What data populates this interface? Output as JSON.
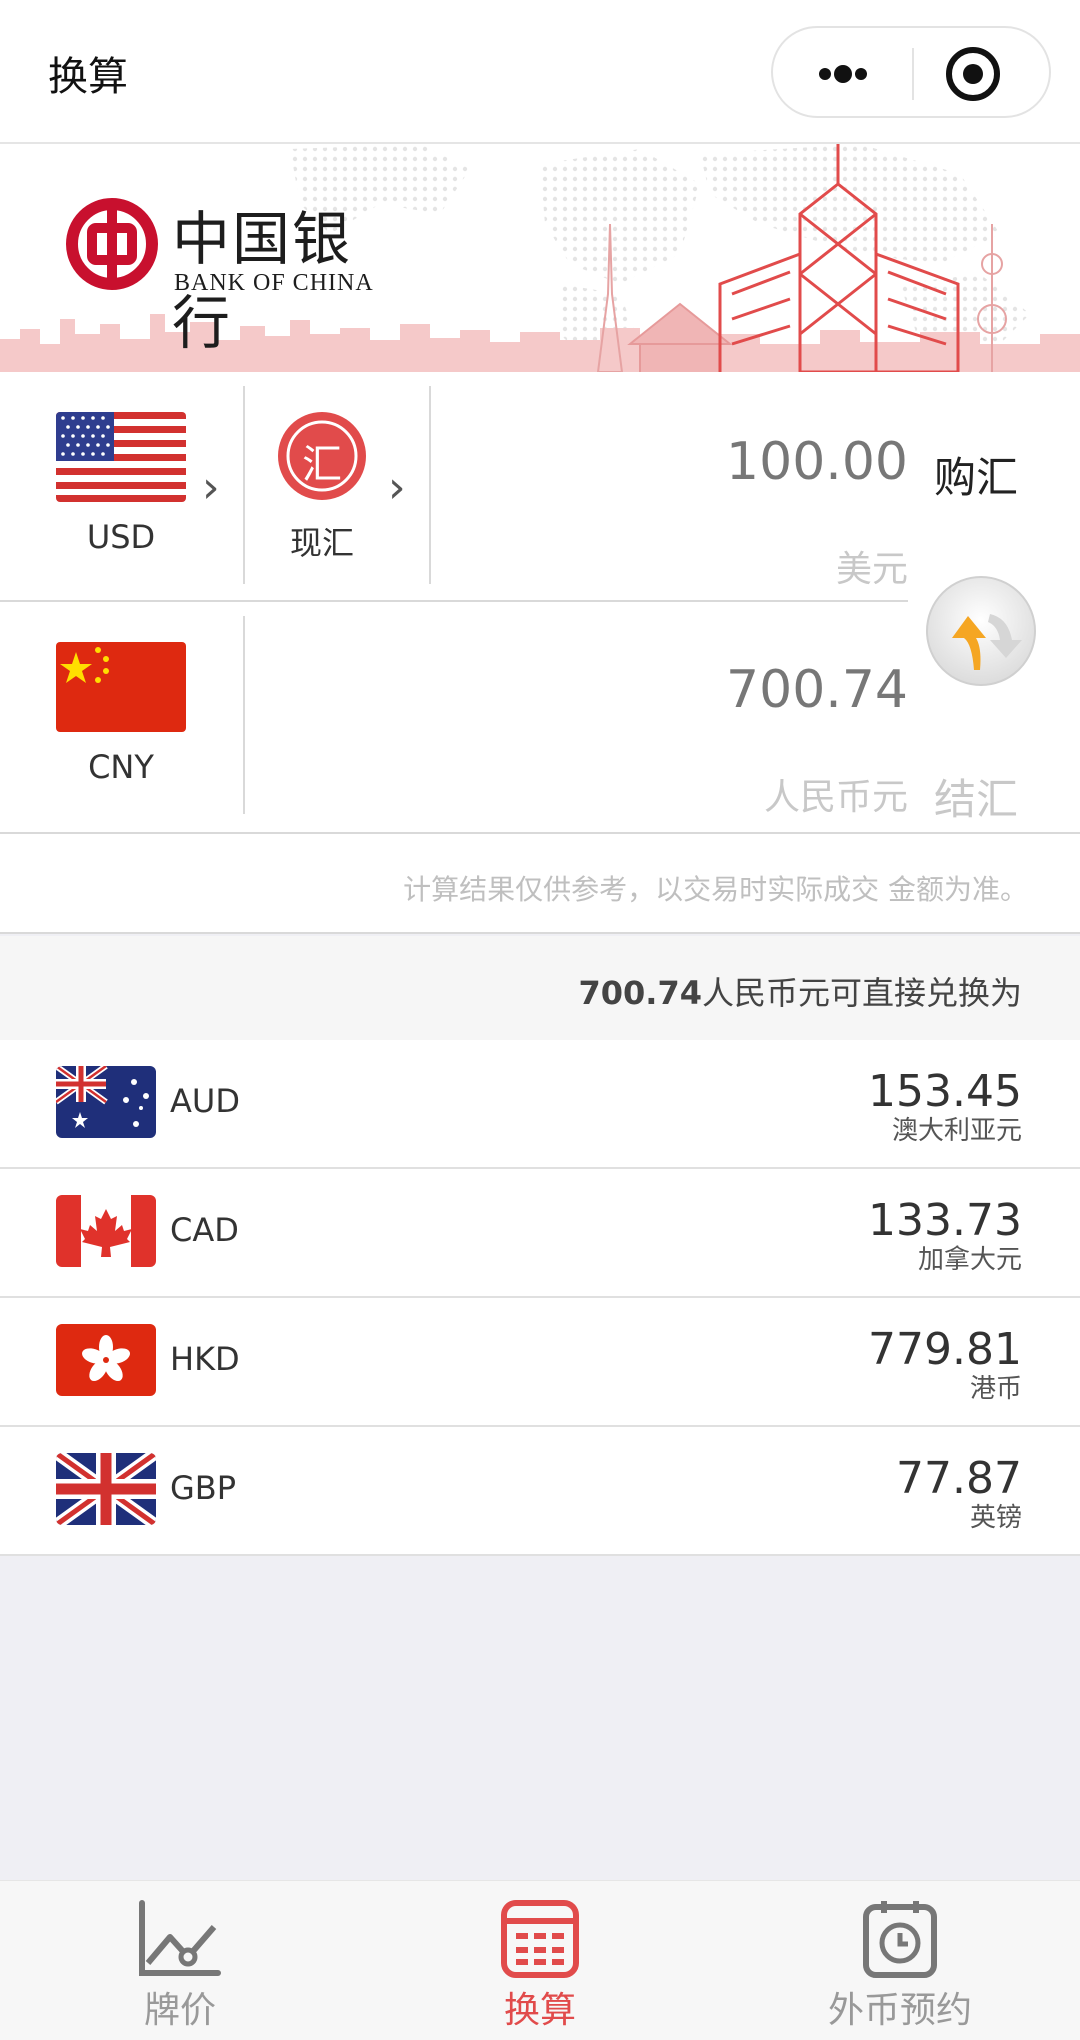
{
  "header": {
    "title": "换算"
  },
  "brand": {
    "name_cn": "中国银行",
    "name_en": "BANK OF CHINA"
  },
  "converter": {
    "from": {
      "code": "USD",
      "rate_type": "现汇",
      "rate_type_icon_char": "汇",
      "amount": "100.00",
      "unit": "美元",
      "action": "购汇"
    },
    "to": {
      "code": "CNY",
      "amount": "700.74",
      "unit": "人民币元",
      "action": "结汇"
    }
  },
  "note": "计算结果仅供参考，以交易时实际成交 金额为准。",
  "summary": {
    "amount": "700.74",
    "text": "人民币元可直接兑换为"
  },
  "currencies": [
    {
      "code": "AUD",
      "value": "153.45",
      "name": "澳大利亚元",
      "flag": "australia-flag"
    },
    {
      "code": "CAD",
      "value": "133.73",
      "name": "加拿大元",
      "flag": "canada-flag"
    },
    {
      "code": "HKD",
      "value": "779.81",
      "name": "港币",
      "flag": "hongkong-flag"
    },
    {
      "code": "GBP",
      "value": "77.87",
      "name": "英镑",
      "flag": "uk-flag"
    }
  ],
  "tabs": [
    {
      "label": "牌价",
      "icon": "chart-icon",
      "active": false
    },
    {
      "label": "换算",
      "icon": "calculator-icon",
      "active": true
    },
    {
      "label": "外币预约",
      "icon": "clock-icon",
      "active": false
    }
  ],
  "colors": {
    "accent": "#e14b4b",
    "swap_orange": "#f5a623",
    "brand_red": "#c8102e"
  }
}
